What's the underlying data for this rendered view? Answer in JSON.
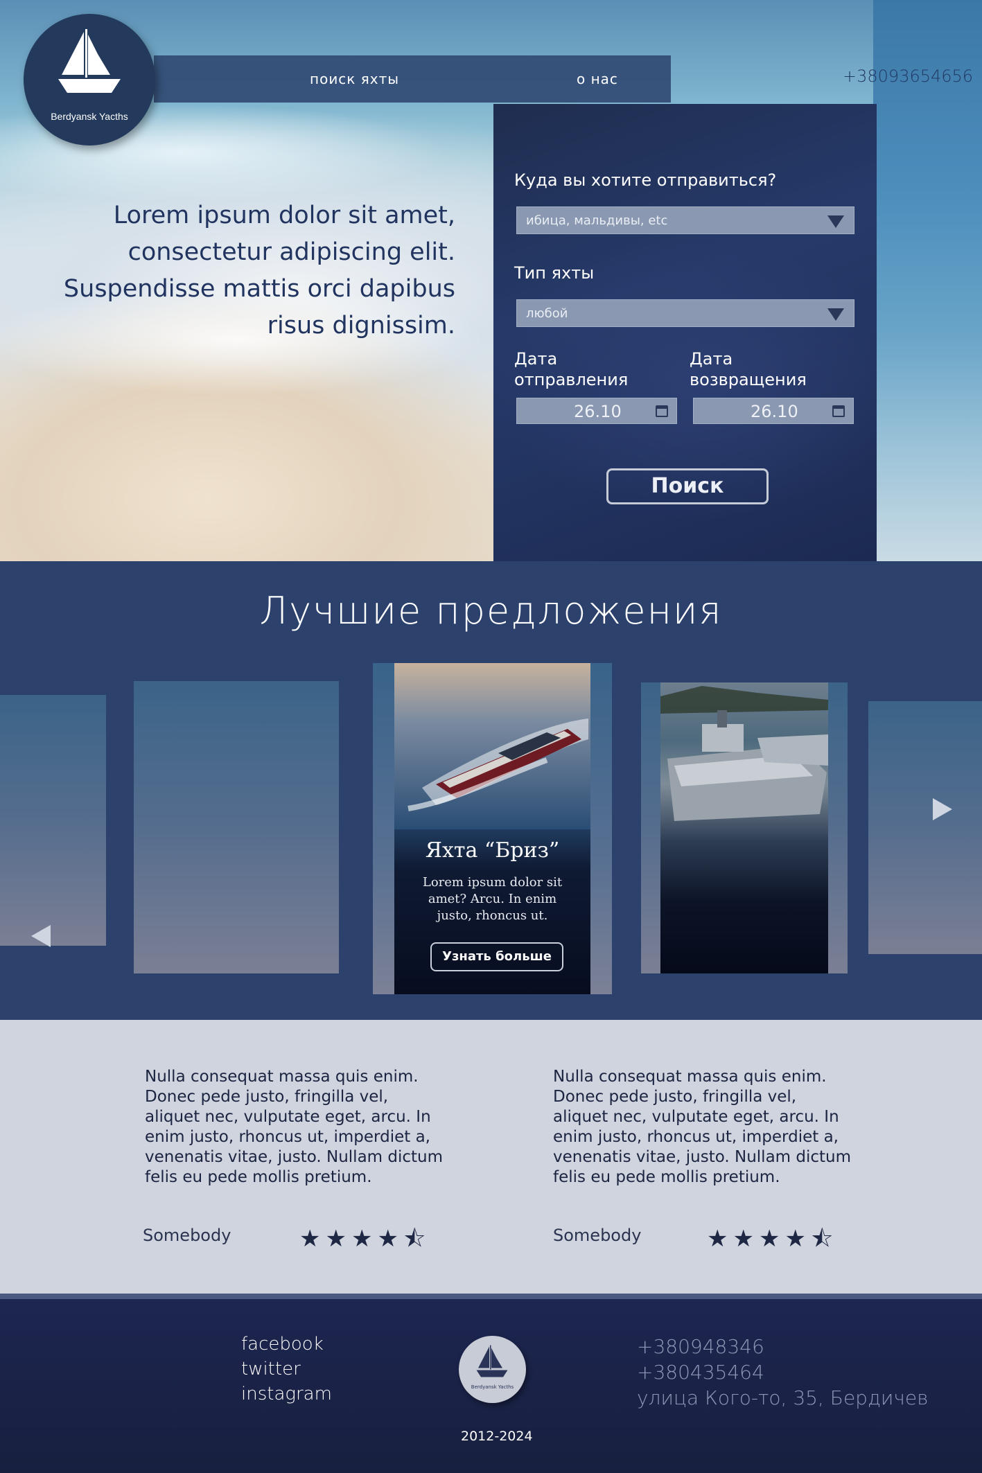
{
  "logo": {
    "text": "Berdyansk Yacths"
  },
  "nav": {
    "search_label": "поиск яхты",
    "about_label": "о нас"
  },
  "header": {
    "phone": "+38093654656"
  },
  "hero": {
    "text": "Lorem ipsum dolor sit amet, consectetur adipiscing elit. Suspendisse mattis orci dapibus risus dignissim."
  },
  "search": {
    "where_label": "Куда вы хотите отправиться?",
    "where_value": "ибица, мальдивы, etc",
    "type_label": "Тип яхты",
    "type_value": "любой",
    "depart_label": "Дата отправления",
    "depart_value": "26.10",
    "return_label": "Дата возвращения",
    "return_value": "26.10",
    "button_label": "Поиск"
  },
  "offers": {
    "title": "Лучшие предложения",
    "featured": {
      "title": "Яхта “Бриз”",
      "description": "Lorem ipsum dolor sit amet? Arcu. In enim justo, rhoncus ut.",
      "button_label": "Узнать больше"
    }
  },
  "reviews": [
    {
      "text": "Nulla consequat massa quis enim. Donec pede justo, fringilla vel, aliquet nec, vulputate eget, arcu. In enim justo, rhoncus ut, imperdiet a, venenatis vitae, justo. Nullam dictum felis eu pede mollis pretium.",
      "author": "Somebody",
      "rating": 4.5
    },
    {
      "text": "Nulla consequat massa quis enim. Donec pede justo, fringilla vel, aliquet nec, vulputate eget, arcu. In enim justo, rhoncus ut, imperdiet a, venenatis vitae, justo. Nullam dictum felis eu pede mollis pretium.",
      "author": "Somebody",
      "rating": 4.5
    }
  ],
  "footer": {
    "social": [
      "facebook",
      "twitter",
      "instagram"
    ],
    "logo_text": "Berdyansk Yacths",
    "years": "2012-2024",
    "phone1": "+380948346",
    "phone2": "+380435464",
    "address": "улица Кого-то, 35, Бердичев"
  },
  "colors": {
    "primary_dark": "#2c426c",
    "accent_light": "#d0d4de",
    "footer": "#1b2349"
  }
}
